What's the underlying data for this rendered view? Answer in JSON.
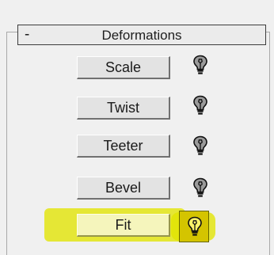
{
  "rollout": {
    "collapse_symbol": "-",
    "title": "Deformations"
  },
  "deformations": [
    {
      "label": "Scale",
      "bulb_state": "off"
    },
    {
      "label": "Twist",
      "bulb_state": "off"
    },
    {
      "label": "Teeter",
      "bulb_state": "off"
    },
    {
      "label": "Bevel",
      "bulb_state": "off"
    },
    {
      "label": "Fit",
      "bulb_state": "on"
    }
  ],
  "icons": {
    "bulb_off": "lightbulb-off-icon",
    "bulb_on": "lightbulb-on-icon"
  },
  "colors": {
    "highlight": "#e2e400",
    "active_bulb_bg": "#d4c400",
    "bulb_on_fill": "#fff36a"
  }
}
